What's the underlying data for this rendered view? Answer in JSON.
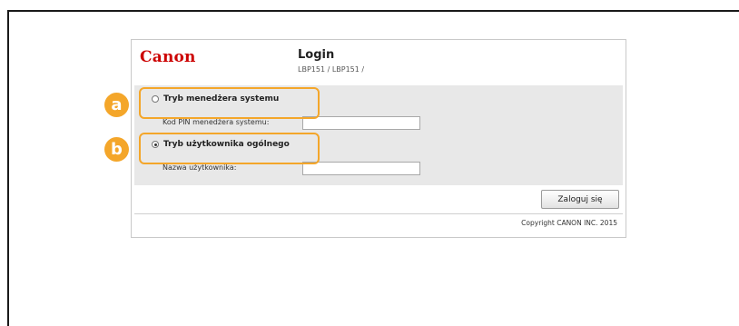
{
  "window": {
    "logo": "Canon",
    "title": "Login",
    "device": "LBP151 / LBP151 /"
  },
  "form": {
    "options": [
      {
        "label": "Tryb menedżera systemu",
        "selected": false
      },
      {
        "label": "Tryb użytkownika ogólnego",
        "selected": true
      }
    ],
    "pin_label": "Kod PIN menedżera systemu:",
    "pin_value": "",
    "user_label": "Nazwa użytkownika:",
    "user_value": "",
    "submit_label": "Zaloguj się"
  },
  "footer": {
    "copyright": "Copyright CANON INC. 2015"
  },
  "callouts": [
    {
      "letter": "a",
      "target": "Tryb menedżera systemu"
    },
    {
      "letter": "b",
      "target": "Tryb użytkownika ogólnego"
    }
  ],
  "colors": {
    "brand_red": "#cc0000",
    "callout_orange": "#f4a62a",
    "panel_gray": "#e8e8e8"
  }
}
